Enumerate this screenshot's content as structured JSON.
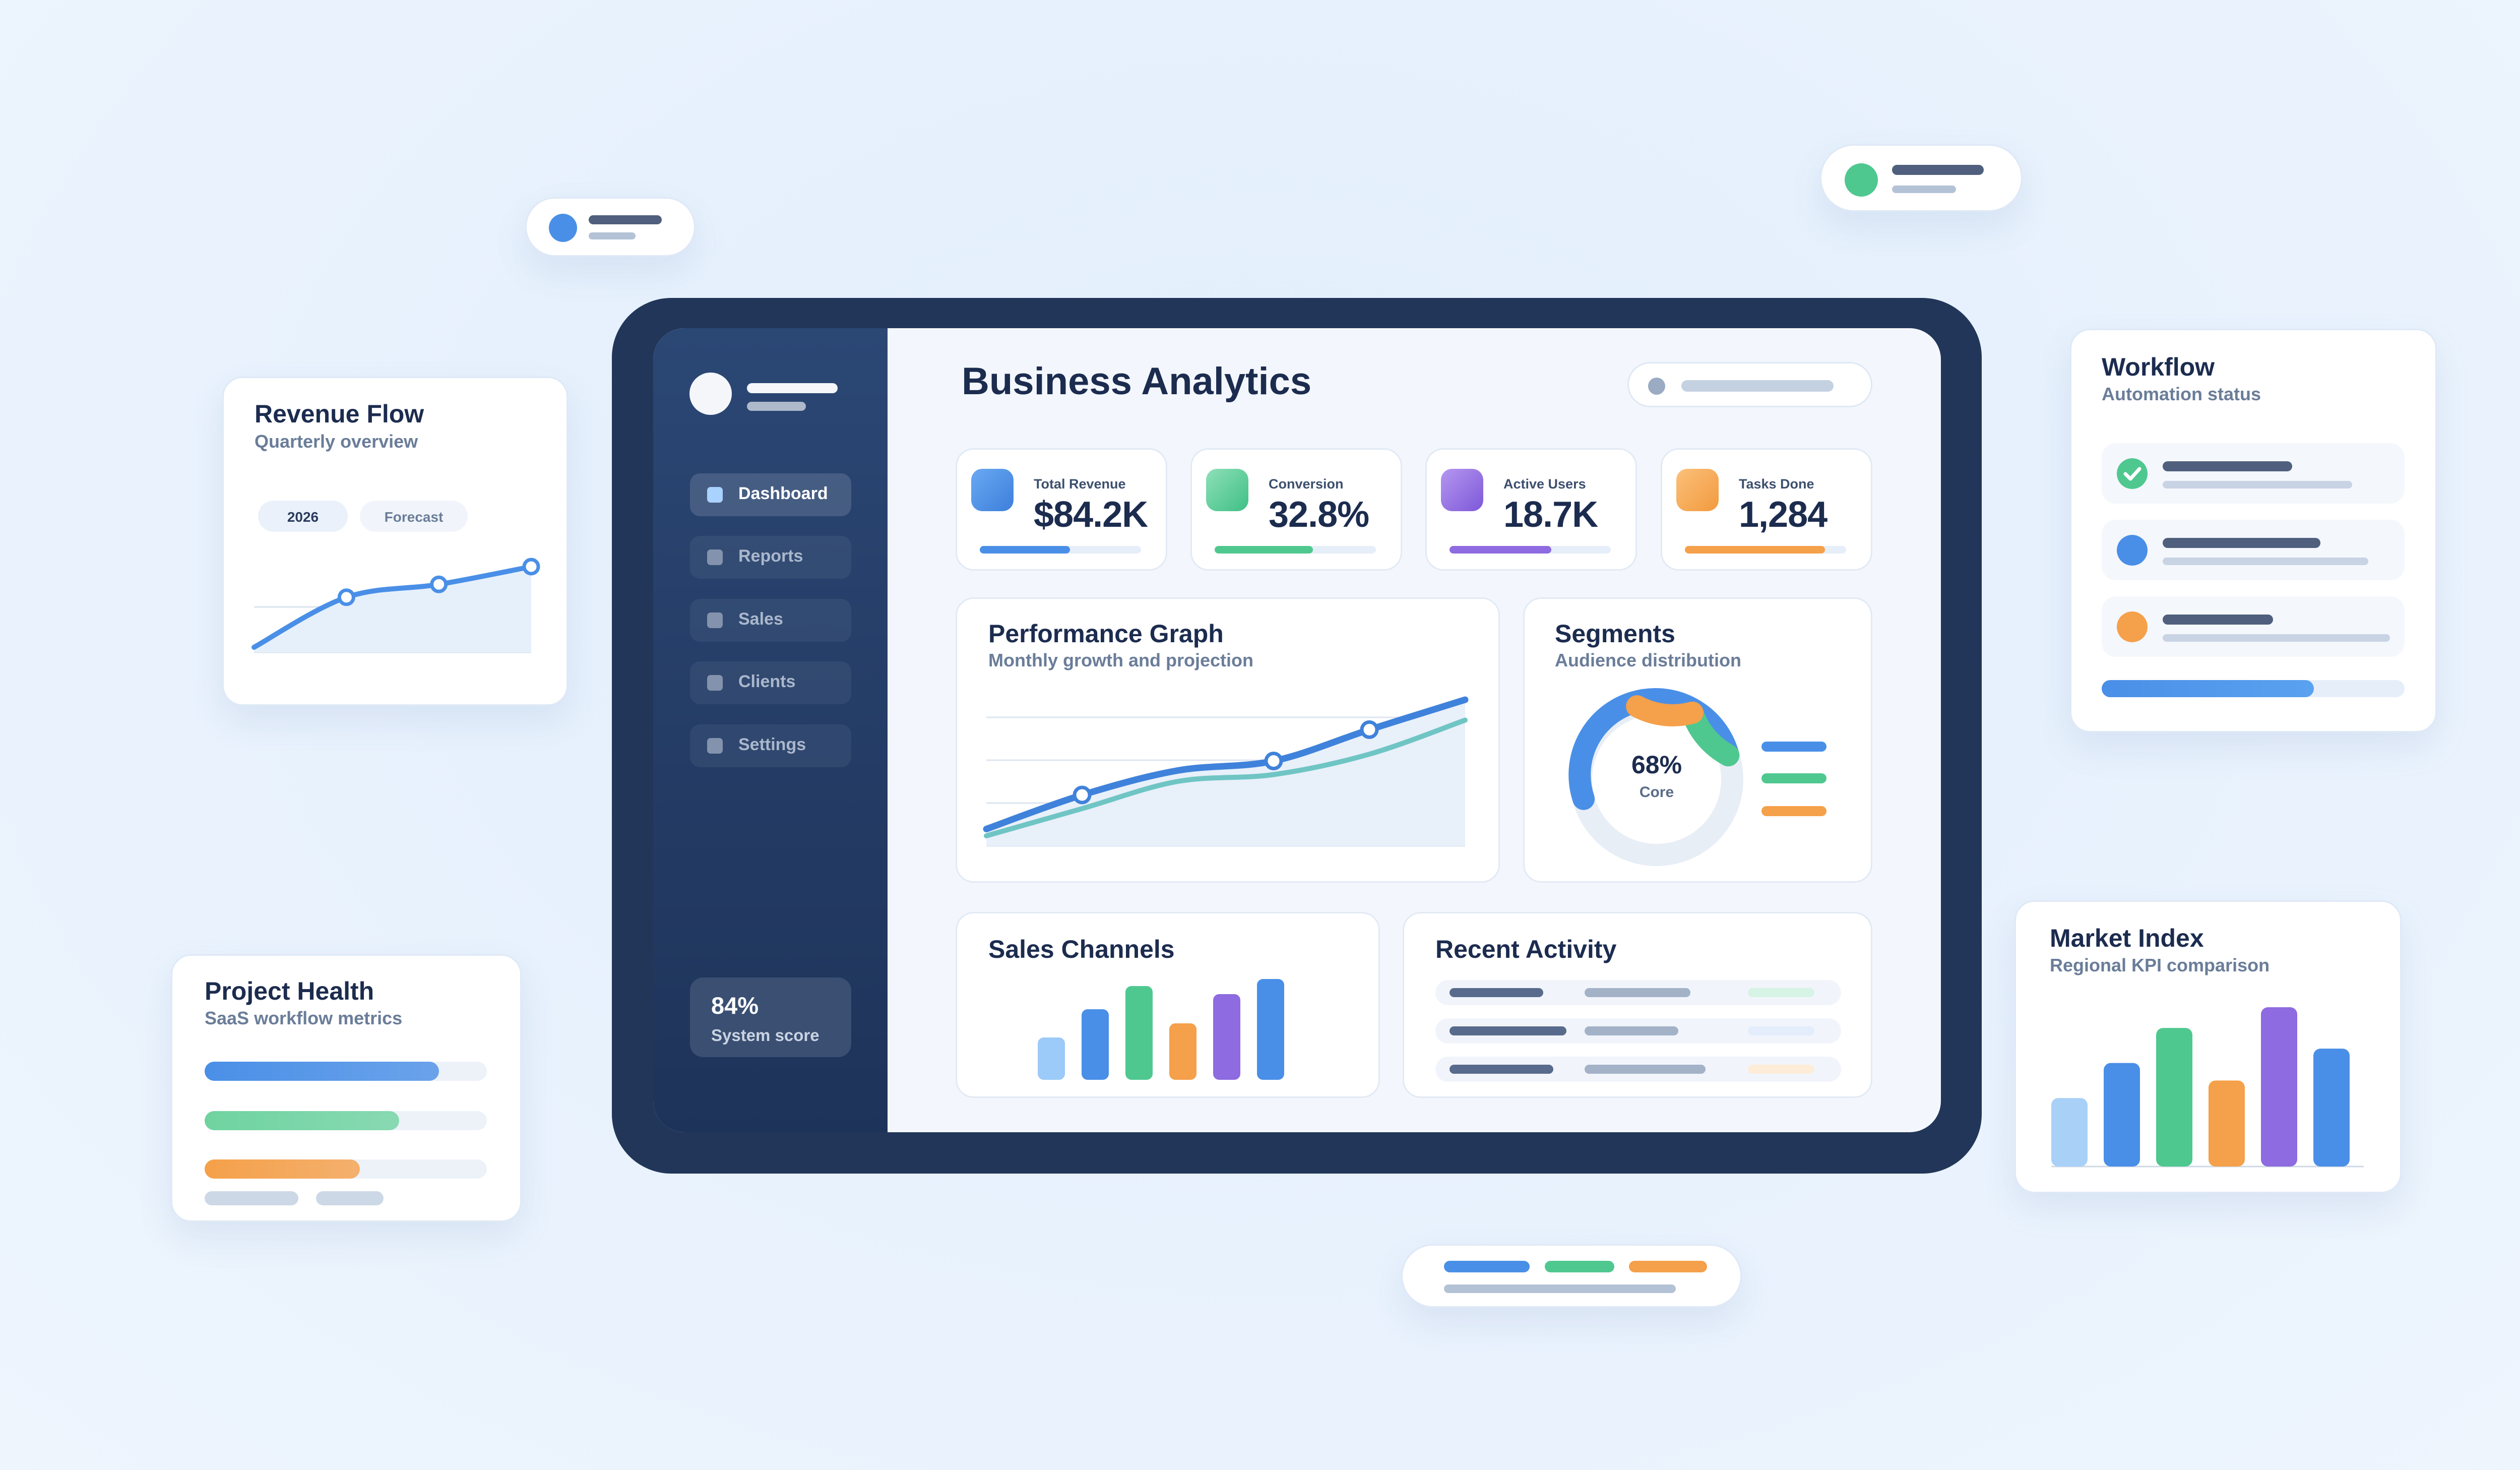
{
  "dashboard": {
    "title": "Business Analytics",
    "nav": [
      {
        "label": "Dashboard",
        "active": true
      },
      {
        "label": "Reports"
      },
      {
        "label": "Sales"
      },
      {
        "label": "Clients"
      },
      {
        "label": "Settings"
      }
    ],
    "system_score": {
      "value": "84%",
      "label": "System score"
    },
    "kpis": [
      {
        "label": "Total Revenue",
        "value": "$84.2K",
        "color": "#4a8fe7",
        "progress": 0.56
      },
      {
        "label": "Conversion",
        "value": "32.8%",
        "color": "#4fc88f",
        "progress": 0.61
      },
      {
        "label": "Active Users",
        "value": "18.7K",
        "color": "#8e6be0",
        "progress": 0.63
      },
      {
        "label": "Tasks Done",
        "value": "1,284",
        "color": "#f5a04a",
        "progress": 0.87
      }
    ],
    "performance": {
      "title": "Performance Graph",
      "subtitle": "Monthly growth and projection"
    },
    "segments": {
      "title": "Segments",
      "subtitle": "Audience distribution",
      "center_value": "68%",
      "center_label": "Core"
    },
    "sales_channels": {
      "title": "Sales Channels"
    },
    "recent_activity": {
      "title": "Recent Activity"
    }
  },
  "revenue_flow": {
    "title": "Revenue Flow",
    "subtitle": "Quarterly overview",
    "chips": [
      "2026",
      "Forecast"
    ]
  },
  "project_health": {
    "title": "Project Health",
    "subtitle": "SaaS workflow metrics",
    "bars": [
      {
        "color": "#4a8fe7",
        "progress": 0.83
      },
      {
        "color": "#6fd3a0",
        "progress": 0.69
      },
      {
        "color": "#f5a04a",
        "progress": 0.55
      }
    ]
  },
  "workflow": {
    "title": "Workflow",
    "subtitle": "Automation status",
    "items": [
      {
        "status": "check-icon",
        "color": "#4fc88f"
      },
      {
        "status": "dot",
        "color": "#4a8fe7"
      },
      {
        "status": "dot",
        "color": "#f5a04a"
      }
    ],
    "progress": 0.7
  },
  "market_index": {
    "title": "Market Index",
    "subtitle": "Regional KPI comparison"
  },
  "chart_data": [
    {
      "type": "line",
      "title": "Revenue Flow",
      "x": [
        0,
        1,
        2,
        3
      ],
      "series": [
        {
          "values": [
            0.0,
            0.62,
            0.78,
            1.0
          ]
        }
      ],
      "grid": true
    },
    {
      "type": "line",
      "title": "Performance Graph",
      "x": [
        0,
        1,
        2,
        3,
        4,
        5
      ],
      "series": [
        {
          "values": [
            0.05,
            0.3,
            0.48,
            0.55,
            0.78,
            1.0
          ]
        },
        {
          "values": [
            0.0,
            0.2,
            0.4,
            0.45,
            0.6,
            0.85
          ]
        }
      ],
      "grid": true
    },
    {
      "type": "pie",
      "title": "Segments",
      "values": [
        68,
        16,
        16
      ],
      "colors": [
        "#4a8fe7",
        "#4fc88f",
        "#f5a04a"
      ]
    },
    {
      "type": "bar",
      "title": "Sales Channels",
      "values": [
        0.42,
        0.7,
        0.93,
        0.56,
        0.85,
        1.0
      ],
      "colors": [
        "#9ccaf9",
        "#4a8fe7",
        "#4fc88f",
        "#f5a04a",
        "#8e6be0",
        "#4a8fe7"
      ]
    },
    {
      "type": "bar",
      "title": "Market Index",
      "values": [
        0.43,
        0.65,
        0.87,
        0.54,
        1.0,
        0.74
      ],
      "colors": [
        "#a9d0f7",
        "#4a8fe7",
        "#4fc88f",
        "#f5a04a",
        "#8e6be0",
        "#4a8fe7"
      ]
    }
  ],
  "colors": {
    "navy": "#213658",
    "accent": "#4a8fe7",
    "green": "#4fc88f",
    "orange": "#f5a04a",
    "purple": "#8e6be0"
  }
}
